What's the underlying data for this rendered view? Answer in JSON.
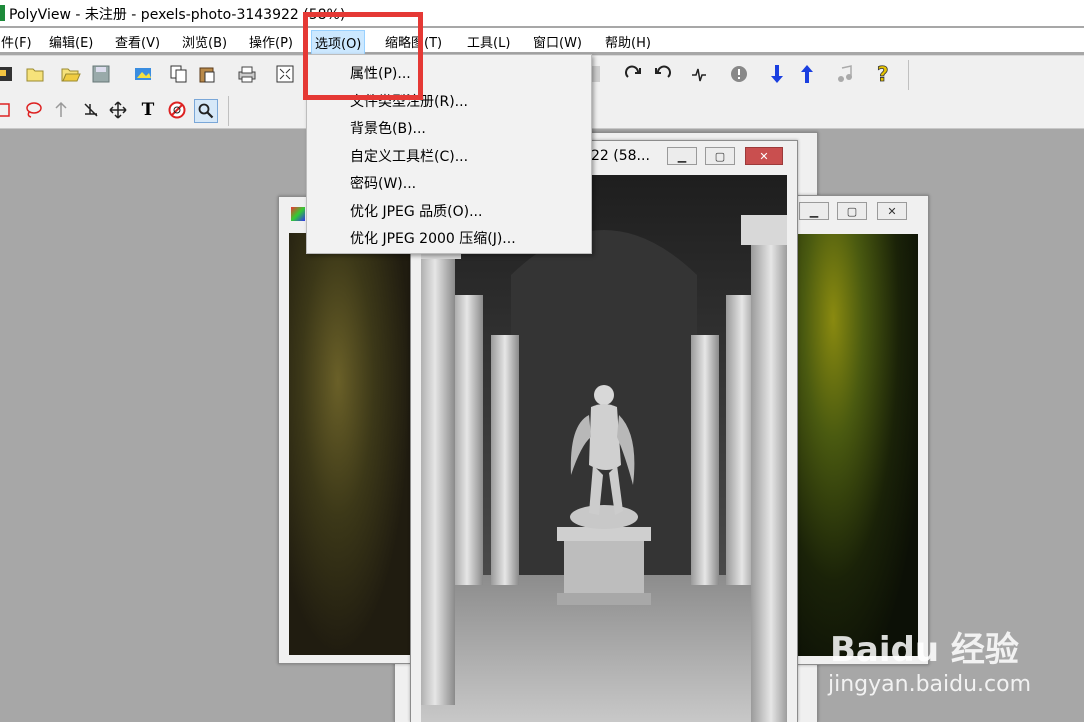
{
  "window": {
    "title": "PolyView - 未注册 - pexels-photo-3143922 (58%)"
  },
  "menubar": [
    {
      "label": "件(F)"
    },
    {
      "label": "编辑(E)"
    },
    {
      "label": "查看(V)"
    },
    {
      "label": "浏览(B)"
    },
    {
      "label": "操作(P)"
    },
    {
      "label": "选项(O)"
    },
    {
      "label": "缩略图(T)"
    },
    {
      "label": "工具(L)"
    },
    {
      "label": "窗口(W)"
    },
    {
      "label": "帮助(H)"
    }
  ],
  "options_menu": [
    {
      "label": "属性(P)..."
    },
    {
      "label": "文件类型注册(R)..."
    },
    {
      "label": "背景色(B)..."
    },
    {
      "label": "自定义工具栏(C)..."
    },
    {
      "label": "密码(W)..."
    },
    {
      "label": "优化 JPEG 品质(O)..."
    },
    {
      "label": "优化 JPEG 2000 压缩(J)..."
    }
  ],
  "center_window": {
    "title_fragment": "22 (58..."
  },
  "toolbar2": {
    "text_tool": "T"
  },
  "watermark": {
    "brand": "Baidu 经验",
    "url": "jingyan.baidu.com"
  },
  "colors": {
    "highlight": "#e53935",
    "menu_active": "#cce8ff",
    "workspace": "#a7a7a7"
  }
}
